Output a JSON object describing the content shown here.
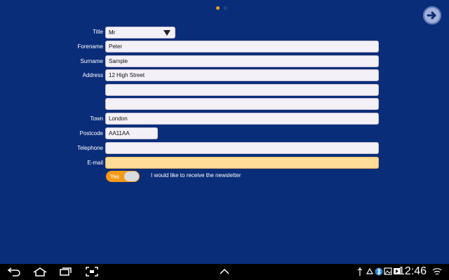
{
  "pager": {
    "active_page": 1,
    "total_pages": 2
  },
  "form": {
    "title_label": "Title",
    "title_value": "Mr",
    "forename_label": "Forename",
    "forename_value": "Peter",
    "surname_label": "Surname",
    "surname_value": "Sample",
    "address_label": "Address",
    "address_line1": "12 High Street",
    "address_line2": "",
    "address_line3": "",
    "town_label": "Town",
    "town_value": "London",
    "postcode_label": "Postcode",
    "postcode_value": "AA11AA",
    "telephone_label": "Telephone",
    "telephone_value": "",
    "email_label": "E-mail",
    "email_value": "",
    "newsletter_toggle_label": "Yes",
    "newsletter_text": "I would like to receive the newsletter"
  },
  "statusbar": {
    "time": "12:46"
  },
  "colors": {
    "background": "#0a2d7a",
    "accent": "#f39a17",
    "email_highlight": "#ffdc97"
  },
  "icons": [
    "arrow-right-circle-icon",
    "dropdown-arrow-icon",
    "back-icon",
    "home-icon",
    "recent-apps-icon",
    "screenshot-icon",
    "chevron-up-icon",
    "usb-icon",
    "recycle-icon",
    "bluetooth-icon",
    "image-icon",
    "media-icon",
    "wifi-icon"
  ]
}
